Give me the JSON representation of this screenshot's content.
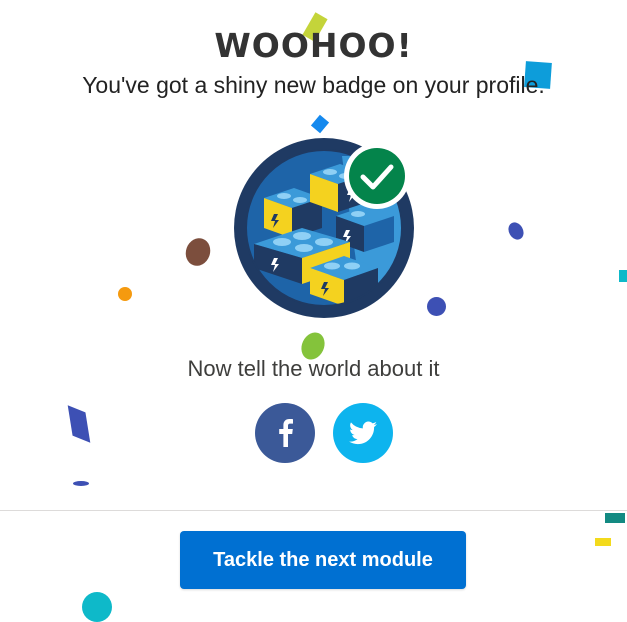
{
  "modal": {
    "title": "WOOHOO!",
    "subtitle": "You've got a shiny new badge on your profile.",
    "share_prompt": "Now tell the world about it",
    "next_button_label": "Tackle the next module"
  },
  "social": [
    {
      "name": "facebook",
      "icon": "facebook-icon",
      "color": "#3b5998"
    },
    {
      "name": "twitter",
      "icon": "twitter-icon",
      "color": "#0db4ee"
    }
  ],
  "colors": {
    "primary_button": "#0070d2",
    "badge_ring": "#1f3a63",
    "checkmark_bg": "#04844b"
  }
}
